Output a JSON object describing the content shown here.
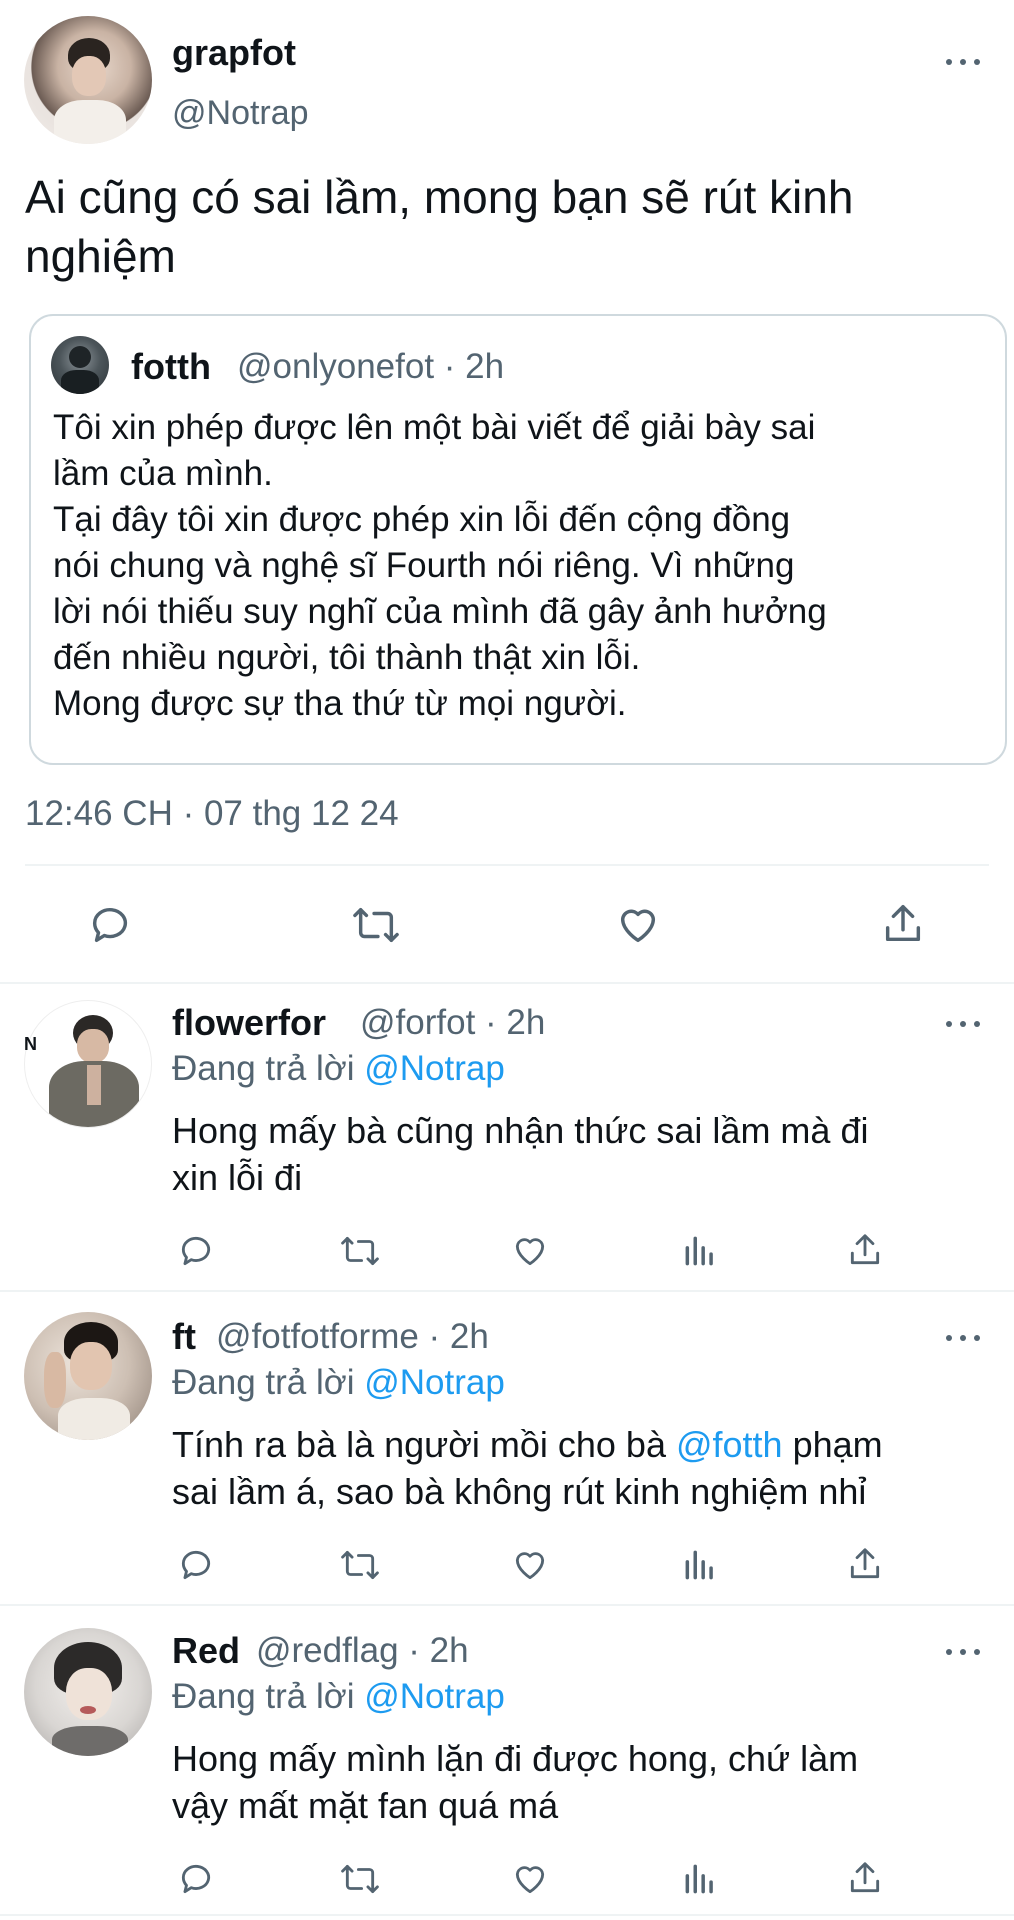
{
  "main_tweet": {
    "display_name": "grapfot",
    "handle": "@Notrap",
    "text_line1": "Ai cũng có sai lầm, mong bạn sẽ rút kinh",
    "text_line2": "nghiệm",
    "timestamp": "12:46 CH · 07 thg 12 24"
  },
  "quoted_tweet": {
    "display_name": "fotth",
    "handle_time": "@onlyonefot · 2h",
    "lines": [
      "Tôi xin phép được lên một bài viết để giải bày sai",
      "lầm của mình.",
      "Tại đây tôi xin được phép xin lỗi đến cộng đồng",
      "nói chung và nghệ sĩ Fourth nói riêng. Vì những",
      "lời nói thiếu suy nghĩ của mình đã gây ảnh hưởng",
      "đến nhiều người, tôi thành thật xin lỗi.",
      "Mong được sự tha thứ từ mọi người."
    ]
  },
  "replies": [
    {
      "display_name": "flowerfor",
      "handle_time": "@forfot · 2h",
      "replying_prefix": "Đang trả lời",
      "replying_to": "@Notrap",
      "line1": "Hong mấy bà cũng nhận thức sai lầm mà đi",
      "line2": "xin lỗi đi",
      "avatar_badge": "N"
    },
    {
      "display_name": "ft",
      "handle_time": "@fotfotforme · 2h",
      "replying_prefix": "Đang trả lời",
      "replying_to": "@Notrap",
      "line1_a": "Tính ra bà là người mồi cho bà ",
      "line1_mention": "@fotth",
      "line1_b": " phạm",
      "line2": "sai lầm á, sao bà không rút kinh nghiệm nhỉ"
    },
    {
      "display_name": "Red",
      "handle_time": "@redflag · 2h",
      "replying_prefix": "Đang trả lời",
      "replying_to": "@Notrap",
      "line1": "Hong mấy mình lặn đi được hong, chứ làm",
      "line2": "vậy mất mặt fan quá má"
    }
  ],
  "colors": {
    "text": "#0f1419",
    "secondary": "#536471",
    "link": "#1d9bf0",
    "divider": "#eff3f4"
  },
  "icons": [
    "reply-icon",
    "retweet-icon",
    "like-icon",
    "views-icon",
    "share-icon",
    "more-icon"
  ]
}
